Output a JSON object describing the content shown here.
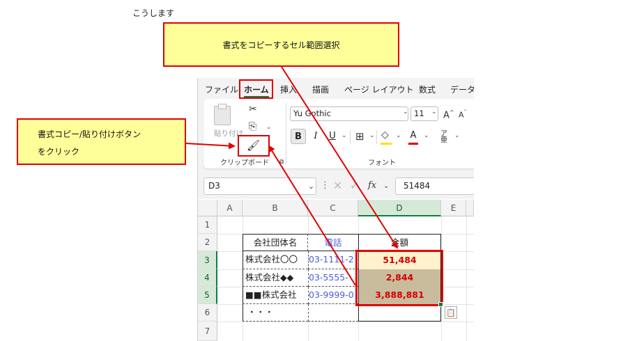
{
  "intro": "こうします",
  "callouts": {
    "top": "書式をコピーするセル範囲選択",
    "left_line1": "書式コピー/貼り付けボタン",
    "left_line2": "をクリック"
  },
  "ribbon": {
    "tabs": [
      "ファイル",
      "ホーム",
      "挿入",
      "描画",
      "ページ レイアウト",
      "数式",
      "データ"
    ],
    "clipboard": {
      "paste_label": "貼り付け",
      "group_label": "クリップボード"
    },
    "font": {
      "font_name": "Yu Gothic",
      "font_size": "11",
      "group_label": "フォント",
      "bold": "B",
      "italic": "I",
      "underline": "U",
      "font_color": "A",
      "grow": "A^",
      "shrink": "Aˇ"
    }
  },
  "formula_bar": {
    "name_box": "D3",
    "fx": "fx",
    "value": "51484"
  },
  "sheet": {
    "columns": [
      "A",
      "B",
      "C",
      "D",
      "E"
    ],
    "rows": [
      "1",
      "2",
      "3",
      "4",
      "5",
      "6",
      "7"
    ],
    "table": {
      "headers": [
        "会社団体名",
        "電話",
        "金額"
      ],
      "rows": [
        {
          "name": "株式会社〇〇",
          "tel": "03-1111-2",
          "amount": "51,484"
        },
        {
          "name": "株式会社◆◆",
          "tel": "03-5555-",
          "amount": "2,844"
        },
        {
          "name": "■■株式会社",
          "tel": "03-9999-0",
          "amount": "3,888,881"
        }
      ],
      "ellipsis": "・・・"
    }
  },
  "colors": {
    "accent_red": "#e00000",
    "callout_fill": "#ffff99",
    "excel_green": "#107c41",
    "amount_fill_selected": "#fff2cc",
    "amount_fill": "#c9bc9c",
    "amount_text": "#d40000",
    "tel_text": "#4a5ee0"
  }
}
